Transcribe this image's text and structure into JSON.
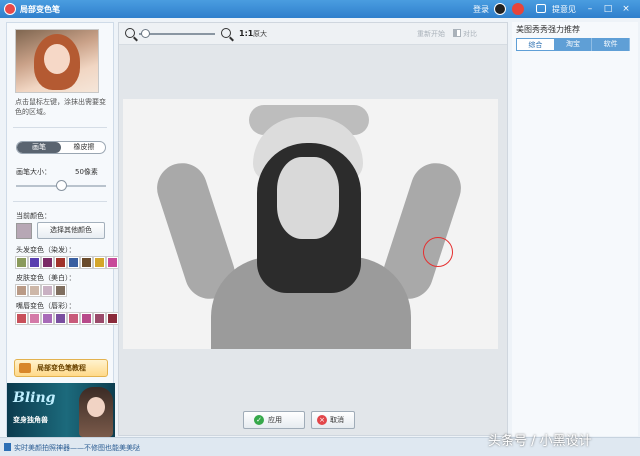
{
  "titlebar": {
    "title": "局部变色笔",
    "login": "登录",
    "feedback": "提意见"
  },
  "left": {
    "hint": "点击鼠标左键，涂抹出需要变色的区域。",
    "modes": [
      "画笔",
      "橡皮擦"
    ],
    "brush_size_label": "画笔大小：",
    "brush_size_value": "50像素",
    "brush_size_level": 0.5,
    "current_color_label": "当前颜色：",
    "current_color": "#b7a7b5",
    "pick_color_button": "选择其他颜色",
    "hair_label": "头发变色（染发）：",
    "hair_colors": [
      "#8a9a5b",
      "#5a3fb0",
      "#7b2a66",
      "#a0322a",
      "#3a5fa0",
      "#6a4b2b",
      "#d4a62a",
      "#c84a9a"
    ],
    "skin_label": "皮肤变色（美白）：",
    "skin_colors": [
      "#b99a86",
      "#cdb7a8",
      "#c9b1c3",
      "#7f6e5f"
    ],
    "lip_label": "嘴唇变色（唇彩）：",
    "lip_colors": [
      "#c8505a",
      "#d47aa8",
      "#a86ab8",
      "#7a4fa0",
      "#c85a7a",
      "#b84a8a",
      "#9a4a6a",
      "#8a2a3a"
    ],
    "tutorial_button": "局部变色笔教程",
    "banner_title": "Bling",
    "banner_subtitle": "变身独角兽"
  },
  "canvas": {
    "ratio": "1:1",
    "ratio_label": "原大",
    "undo": "重新开始",
    "compare": "对比",
    "apply_button": "应用",
    "cancel_button": "取消"
  },
  "right": {
    "title": "美图秀秀强力推荐",
    "tabs": [
      "综合",
      "淘宝",
      "软件"
    ]
  },
  "statusbar": {
    "text": "实时美颜拍照神器——不修图也能美美哒"
  },
  "watermark": "头条号 / 小黑设计"
}
